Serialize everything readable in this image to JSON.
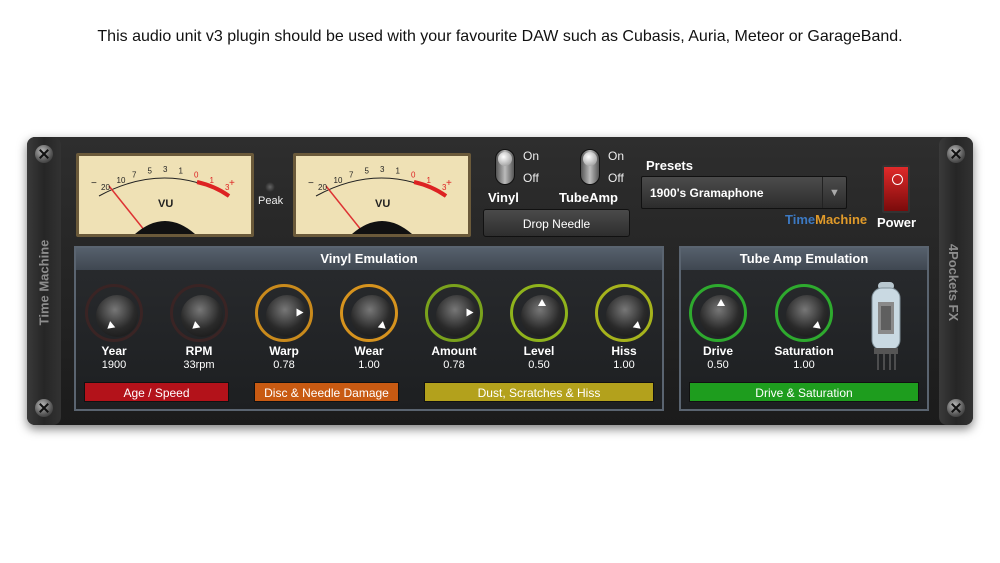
{
  "caption": "This audio unit v3 plugin should be used with your favourite DAW such as Cubasis, Auria, Meteor or GarageBand.",
  "side_left": "Time Machine",
  "side_right": "4Pockets FX",
  "meters": {
    "label": "VU",
    "peak_label": "Peak",
    "scale": [
      "20",
      "10",
      "7",
      "5",
      "3",
      "1",
      "0",
      "1",
      "3"
    ],
    "minus": "−",
    "plus": "+"
  },
  "switches": {
    "vinyl": {
      "on": "On",
      "off": "Off",
      "label": "Vinyl"
    },
    "tubeamp": {
      "on": "On",
      "off": "Off",
      "label": "TubeAmp"
    }
  },
  "drop_needle": "Drop Needle",
  "presets": {
    "label": "Presets",
    "value": "1900's Gramaphone",
    "arrow": "▼"
  },
  "brand": {
    "part1": "Time",
    "part2": "Machine"
  },
  "power_label": "Power",
  "vinyl_section": {
    "title": "Vinyl Emulation",
    "knobs": [
      {
        "name": "Year",
        "value": "1900"
      },
      {
        "name": "RPM",
        "value": "33rpm"
      },
      {
        "name": "Warp",
        "value": "0.78"
      },
      {
        "name": "Wear",
        "value": "1.00"
      },
      {
        "name": "Amount",
        "value": "0.78"
      },
      {
        "name": "Level",
        "value": "0.50"
      },
      {
        "name": "Hiss",
        "value": "1.00"
      }
    ],
    "groups": [
      "Age / Speed",
      "Disc & Needle Damage",
      "Dust, Scratches & Hiss"
    ]
  },
  "tube_section": {
    "title": "Tube Amp Emulation",
    "knobs": [
      {
        "name": "Drive",
        "value": "0.50"
      },
      {
        "name": "Saturation",
        "value": "1.00"
      }
    ],
    "groups": [
      "Drive & Saturation"
    ]
  },
  "colors": {
    "red": "#b3121a",
    "orange": "#c85a12",
    "yellow": "#b3a11c",
    "green": "#1e9d1e"
  }
}
